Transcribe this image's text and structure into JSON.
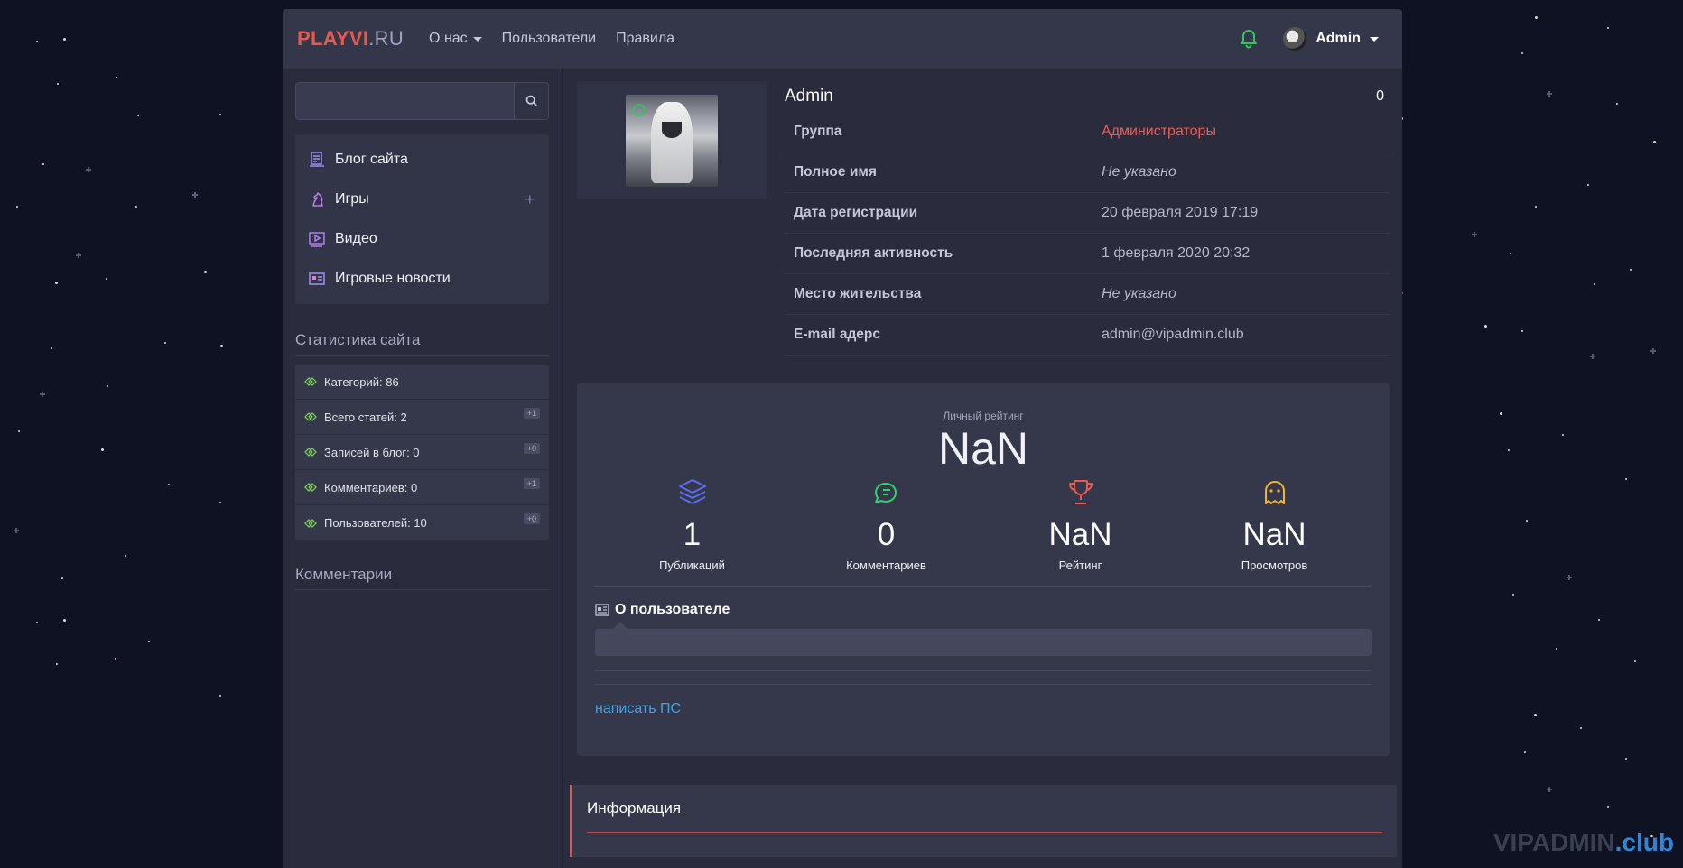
{
  "header": {
    "logo_main": "PLAYVI",
    "logo_suffix": ".RU",
    "nav": [
      "О нас",
      "Пользователи",
      "Правила"
    ],
    "user_name": "Admin"
  },
  "sidebar": {
    "search_value": "",
    "menu": [
      {
        "label": "Блог сайта",
        "icon": "blog-icon"
      },
      {
        "label": "Игры",
        "icon": "chess-knight-icon",
        "expand": "+"
      },
      {
        "label": "Видео",
        "icon": "video-icon"
      },
      {
        "label": "Игровые новости",
        "icon": "news-icon"
      }
    ],
    "stats_title": "Статистика сайта",
    "stats": [
      {
        "label": "Категорий: 86",
        "badge": ""
      },
      {
        "label": "Всего статей: 2",
        "badge": "+1"
      },
      {
        "label": "Записей в блог: 0",
        "badge": "+0"
      },
      {
        "label": "Комментариев: 0",
        "badge": "+1"
      },
      {
        "label": "Пользователей: 10",
        "badge": "+0"
      }
    ],
    "comments_title": "Комментарии"
  },
  "profile": {
    "name": "Admin",
    "count": "0",
    "fields": [
      {
        "key": "Группа",
        "value": "Администраторы",
        "style": "red"
      },
      {
        "key": "Полное имя",
        "value": "Не указано",
        "style": "italic"
      },
      {
        "key": "Дата регистрации",
        "value": "20 февраля 2019 17:19",
        "style": ""
      },
      {
        "key": "Последняя активность",
        "value": "1 февраля 2020 20:32",
        "style": ""
      },
      {
        "key": "Место жительства",
        "value": "Не указано",
        "style": "italic"
      },
      {
        "key": "E-mail адерс",
        "value": "admin@vipadmin.club",
        "style": ""
      }
    ]
  },
  "rating": {
    "label": "Личный рейтинг",
    "value": "NaN",
    "metrics": [
      {
        "num": "1",
        "caption": "Публикаций",
        "icon": "layers-icon",
        "color": "#5b6bf0"
      },
      {
        "num": "0",
        "caption": "Комментариев",
        "icon": "comments-icon",
        "color": "#2fd36a"
      },
      {
        "num": "NaN",
        "caption": "Рейтинг",
        "icon": "trophy-icon",
        "color": "#ee5a4a"
      },
      {
        "num": "NaN",
        "caption": "Просмотров",
        "icon": "ghost-icon",
        "color": "#f0b429"
      }
    ],
    "about_title": "О пользователе",
    "pm_link": "написать ПС"
  },
  "infobox": {
    "title": "Информация"
  },
  "watermark": {
    "a": "VIPADMIN",
    "b": ".club"
  },
  "colors": {
    "accent": "#e55a4e",
    "link": "#3ea4e6",
    "online": "#36c55d"
  }
}
